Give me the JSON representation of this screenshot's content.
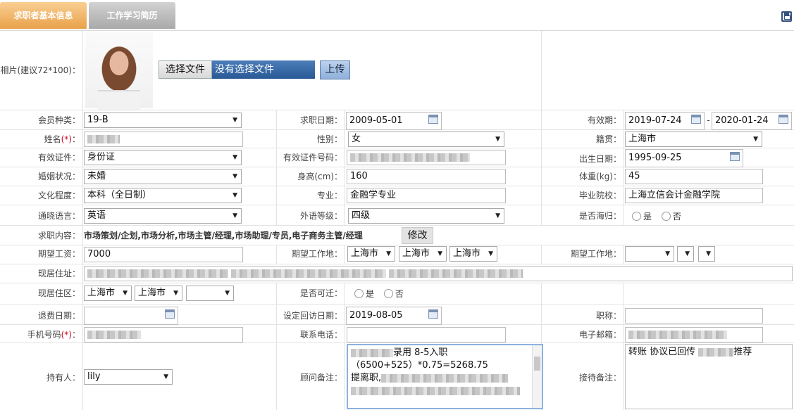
{
  "tabs": {
    "active": "求职者基本信息",
    "inactive": "工作学习简历"
  },
  "photo": {
    "label": "相片(建议72*100)：",
    "choose_label": "选择文件",
    "no_file": "没有选择文件",
    "upload_label": "上传"
  },
  "labels": {
    "member_type": "会员种类：",
    "apply_date": "求职日期：",
    "valid_period": "有效期：",
    "name": "姓名",
    "gender": "性别：",
    "origin": "籍贯：",
    "id_type": "有效证件：",
    "id_number": "有效证件号码：",
    "birth_date": "出生日期：",
    "marital": "婚姻状况：",
    "height": "身高(cm)：",
    "weight": "体重(kg)：",
    "education": "文化程度：",
    "major": "专业：",
    "school": "毕业院校：",
    "language": "通晓语言：",
    "lang_level": "外语等级：",
    "returnee": "是否海归：",
    "job_content": "求职内容：",
    "salary": "期望工资：",
    "work_place": "期望工作地：",
    "work_place2": "期望工作地：",
    "address": "现居住址：",
    "district": "现居住区：",
    "relocate": "是否可迁：",
    "refund_date": "退费日期：",
    "visit_date": "设定回访日期：",
    "title": "职称：",
    "mobile": "手机号码",
    "phone": "联系电话：",
    "email": "电子邮箱：",
    "holder": "持有人：",
    "consultant_note": "顾问备注：",
    "reception_note": "接待备注：",
    "required_mark": "(*)",
    "colon": "："
  },
  "values": {
    "member_type": "19-B",
    "apply_date": "2009-05-01",
    "valid_from": "2019-07-24",
    "valid_sep": "-",
    "valid_to": "2020-01-24",
    "gender": "女",
    "origin": "上海市",
    "id_type": "身份证",
    "birth_date": "1995-09-25",
    "marital": "未婚",
    "height": "160",
    "weight": "45",
    "education": "本科（全日制）",
    "major": "金融学专业",
    "school": "上海立信会计金融学院",
    "language": "英语",
    "lang_level": "四级",
    "job_content": "市场策划/企划,市场分析,市场主管/经理,市场助理/专员,电子商务主管/经理",
    "modify_label": "修改",
    "salary": "7000",
    "wp1": "上海市",
    "wp2": "上海市",
    "wp3": "上海市",
    "district1": "上海市",
    "district2": "上海市",
    "visit_date": "2019-08-05",
    "holder": "lily",
    "consultant_note_l1": "录用  8-5入职",
    "consultant_note_l2": "（6500+525）*0.75=5268.75",
    "consultant_note_l3": "提离职,",
    "reception_note_a": "转账 协议已回传 ",
    "reception_note_b": "推荐",
    "yes": "是",
    "no": "否"
  },
  "icons": {
    "save": "save-icon",
    "calendar": "calendar-icon",
    "dropdown": "chevron-down-icon"
  }
}
